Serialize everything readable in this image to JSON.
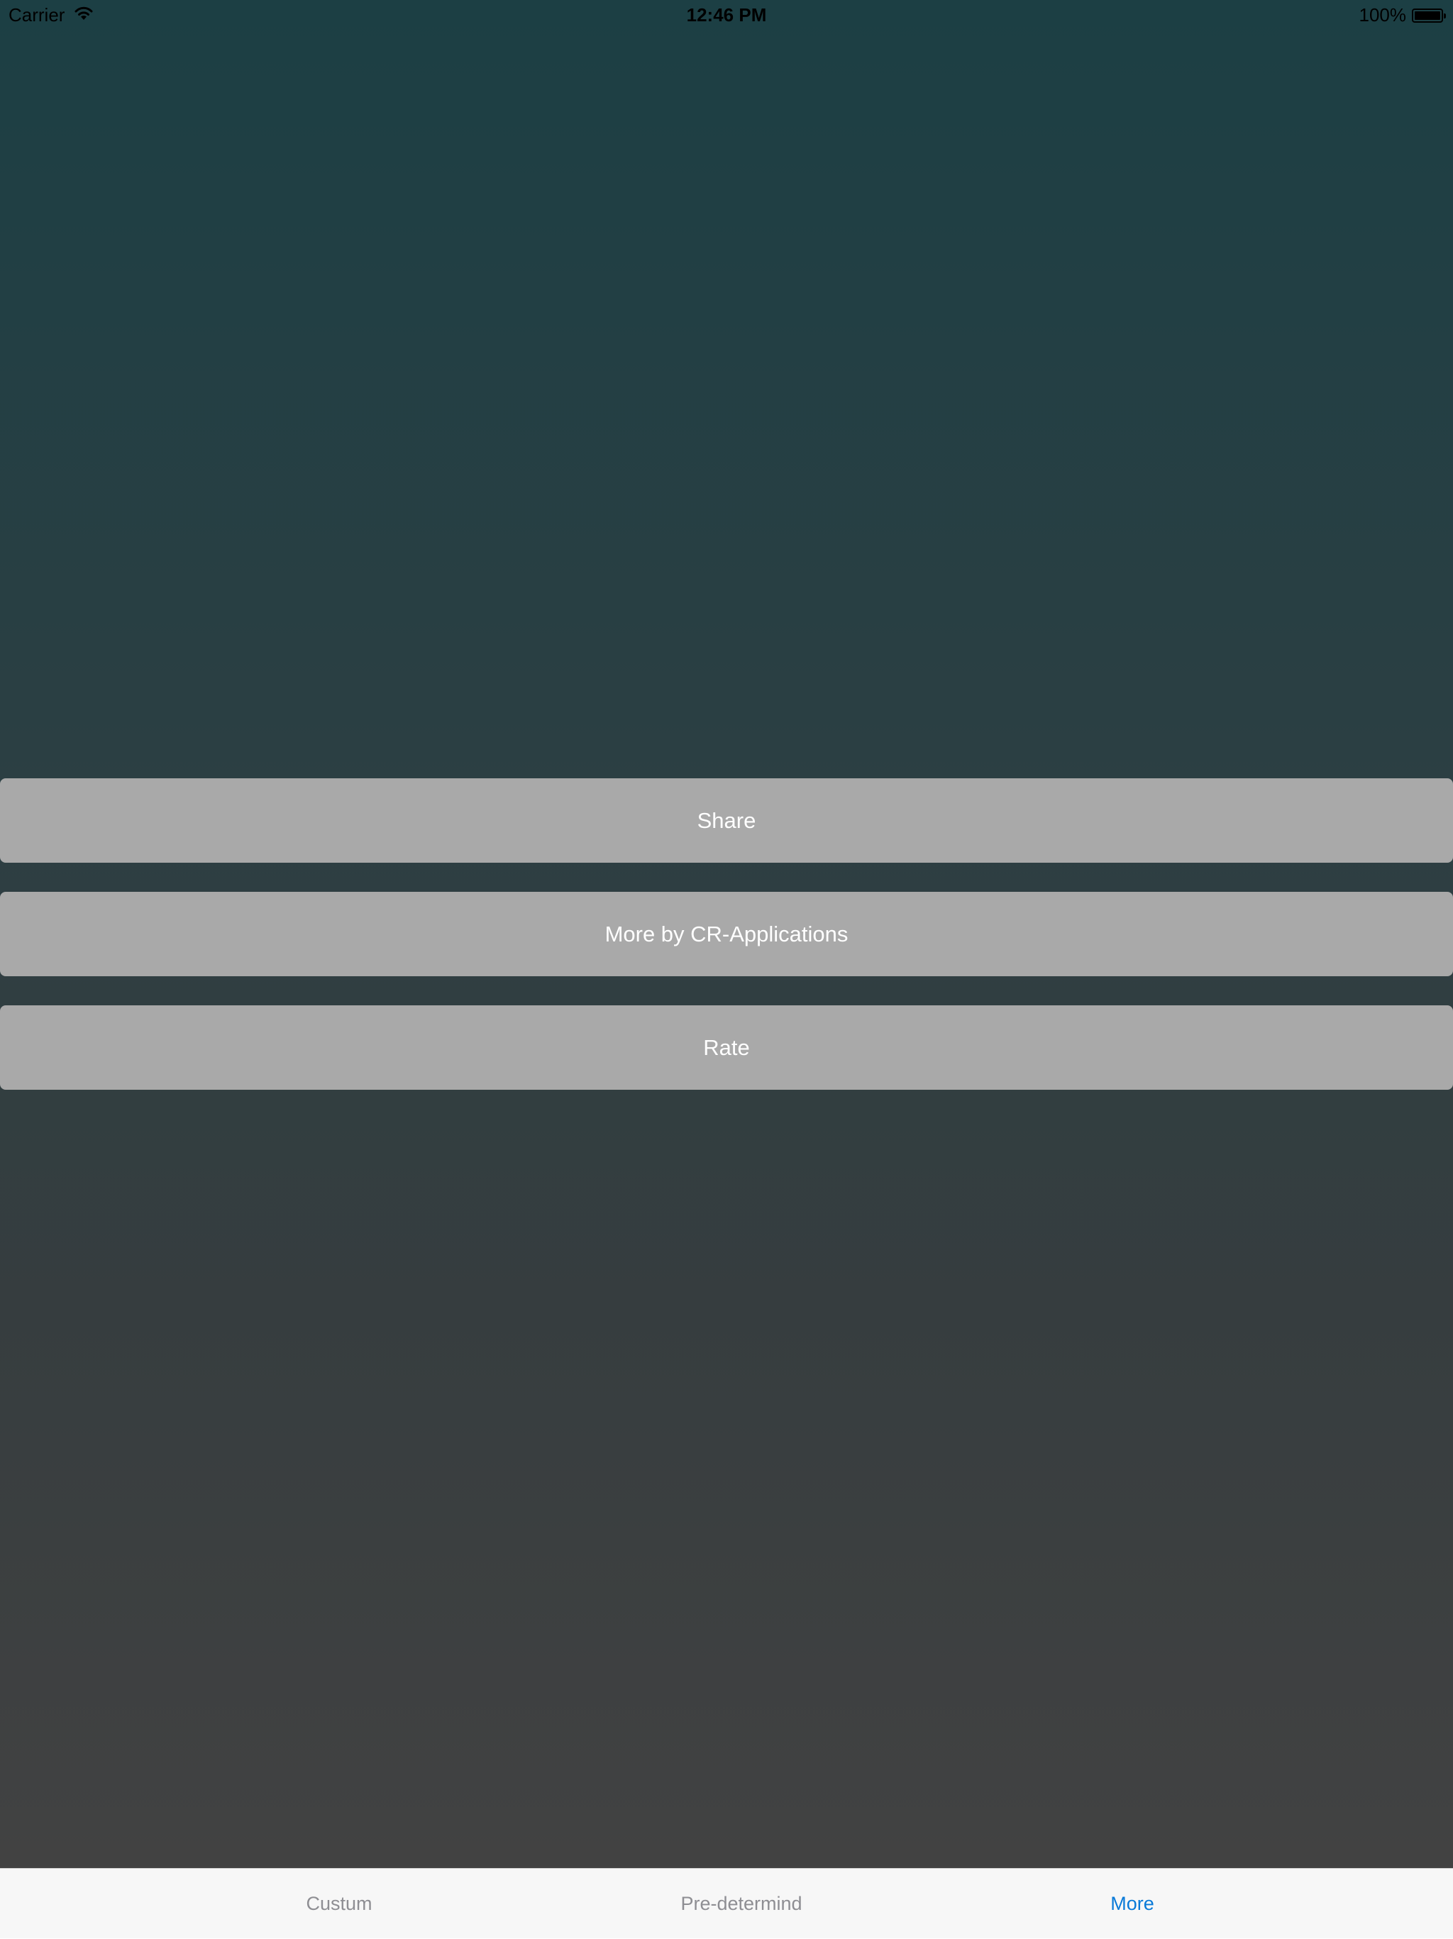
{
  "status_bar": {
    "carrier": "Carrier",
    "time": "12:46 PM",
    "battery": "100%"
  },
  "buttons": {
    "share": "Share",
    "more_by": "More by CR-Applications",
    "rate": "Rate"
  },
  "tab_bar": {
    "tabs": [
      {
        "label": "Custum",
        "selected": false
      },
      {
        "label": "Pre-determind",
        "selected": false
      },
      {
        "label": "More",
        "selected": true
      }
    ]
  },
  "colors": {
    "background_top": "#1c3f44",
    "background_bottom": "#424242",
    "button": "#a9a9a9",
    "tab_active": "#0a7ad8",
    "tab_inactive": "#8e8e93"
  }
}
